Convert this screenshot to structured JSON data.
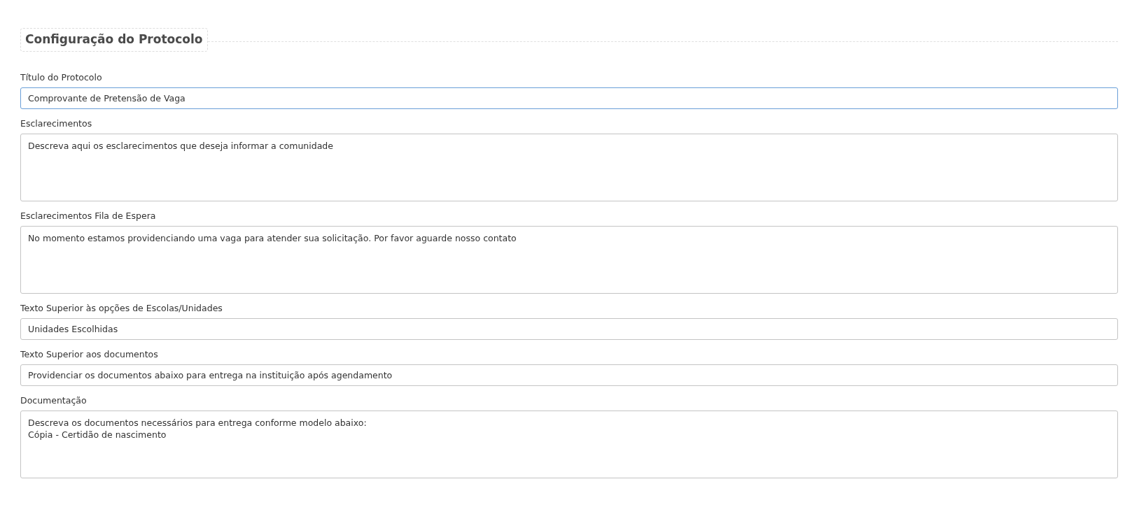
{
  "section": {
    "title": "Configuração do Protocolo"
  },
  "fields": [
    {
      "label": "Título do Protocolo",
      "kind": "input",
      "value": "Comprovante de Pretensão de Vaga",
      "focused": true
    },
    {
      "label": "Esclarecimentos",
      "kind": "textarea",
      "value": "Descreva aqui os esclarecimentos que deseja informar a comunidade",
      "focused": false
    },
    {
      "label": "Esclarecimentos Fila de Espera",
      "kind": "textarea",
      "value": "No momento estamos providenciando uma vaga para atender sua solicitação. Por favor aguarde nosso contato",
      "focused": false
    },
    {
      "label": "Texto Superior às opções de Escolas/Unidades",
      "kind": "input",
      "value": "Unidades Escolhidas",
      "focused": false
    },
    {
      "label": "Texto Superior aos documentos",
      "kind": "input",
      "value": "Providenciar os documentos abaixo para entrega na instituição após agendamento",
      "focused": false
    },
    {
      "label": "Documentação",
      "kind": "textarea",
      "value": "Descreva os documentos necessários para entrega conforme modelo abaixo:\nCópia - Certidão de nascimento",
      "focused": false
    }
  ]
}
